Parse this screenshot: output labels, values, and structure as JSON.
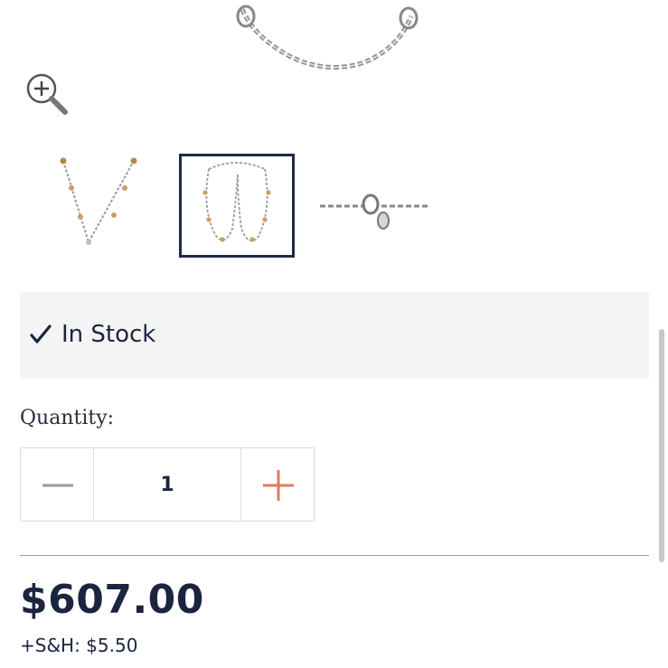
{
  "icons": {
    "zoom": "zoom-in-icon",
    "check": "checkmark-icon",
    "minus": "minus-icon",
    "plus": "plus-icon"
  },
  "colors": {
    "text": "#1b2540",
    "accent_plus": "#e07a5f",
    "minus": "#9a9a9a",
    "stock_bg": "#f4f4f4",
    "selected_border": "#1f2a44"
  },
  "gallery": {
    "selected_index": 1,
    "thumbnails": [
      "necklace-v-front",
      "necklace-long-loop",
      "clasp-detail"
    ]
  },
  "stock": {
    "status": "In Stock"
  },
  "quantity": {
    "label": "Quantity:",
    "value": "1"
  },
  "price": {
    "amount": "$607.00",
    "shipping": "+S&H: $5.50"
  }
}
